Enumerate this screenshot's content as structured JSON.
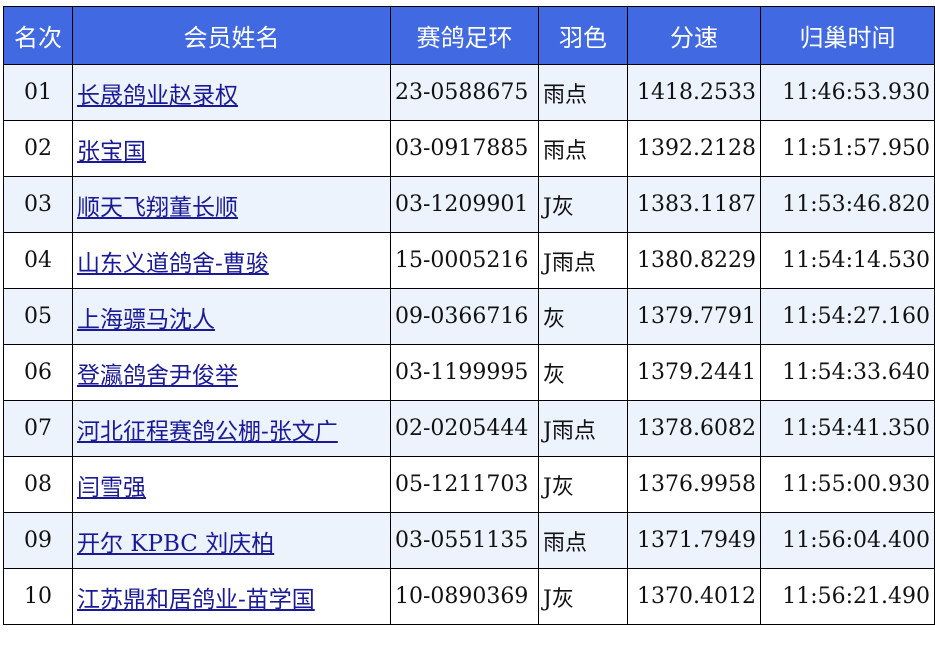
{
  "headers": {
    "rank": "名次",
    "member": "会员姓名",
    "ring": "赛鸽足环",
    "color": "羽色",
    "speed": "分速",
    "time": "归巢时间"
  },
  "rows": [
    {
      "rank": "01",
      "name": "长晟鸽业赵录权",
      "ring": "23-0588675",
      "color": "雨点",
      "speed": "1418.2533",
      "time": "11:46:53.930"
    },
    {
      "rank": "02",
      "name": "张宝国",
      "ring": "03-0917885",
      "color": "雨点",
      "speed": "1392.2128",
      "time": "11:51:57.950"
    },
    {
      "rank": "03",
      "name": "顺天飞翔董长顺",
      "ring": "03-1209901",
      "color": "J灰",
      "speed": "1383.1187",
      "time": "11:53:46.820"
    },
    {
      "rank": "04",
      "name": "山东义道鸽舍-曹骏",
      "ring": "15-0005216",
      "color": "J雨点",
      "speed": "1380.8229",
      "time": "11:54:14.530"
    },
    {
      "rank": "05",
      "name": "上海骠马沈人",
      "ring": "09-0366716",
      "color": "灰",
      "speed": "1379.7791",
      "time": "11:54:27.160"
    },
    {
      "rank": "06",
      "name": "登瀛鸽舍尹俊举",
      "ring": "03-1199995",
      "color": "灰",
      "speed": "1379.2441",
      "time": "11:54:33.640"
    },
    {
      "rank": "07",
      "name": "河北征程赛鸽公棚-张文广",
      "ring": "02-0205444",
      "color": "J雨点",
      "speed": "1378.6082",
      "time": "11:54:41.350"
    },
    {
      "rank": "08",
      "name": "闫雪强",
      "ring": "05-1211703",
      "color": "J灰",
      "speed": "1376.9958",
      "time": "11:55:00.930"
    },
    {
      "rank": "09",
      "name": "开尔 KPBC 刘庆柏",
      "ring": "03-0551135",
      "color": "雨点",
      "speed": "1371.7949",
      "time": "11:56:04.400"
    },
    {
      "rank": "10",
      "name": "江苏鼎和居鸽业-苗学国",
      "ring": "10-0890369",
      "color": "J灰",
      "speed": "1370.4012",
      "time": "11:56:21.490"
    }
  ]
}
